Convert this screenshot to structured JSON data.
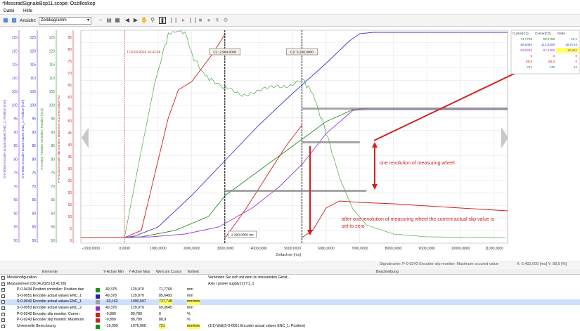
{
  "window": {
    "title": "*MessradSignaleBsp11.scope: Oszilloskop"
  },
  "menu": {
    "file": "Datei",
    "help": "Hilfe"
  },
  "toolbar": {
    "view_label": "Ansicht:",
    "view_value": "Zeitdiagramm"
  },
  "axes": {
    "left": [
      {
        "label": "S-0-0053 Encoder actual values ENC_2: Position [mm]",
        "color": "#7a2fd0",
        "ticks": [
          "125",
          "120",
          "115",
          "110",
          "105",
          "100",
          "95",
          "90",
          "85",
          "80",
          "75",
          "70",
          "65",
          "60",
          "55",
          "50"
        ]
      },
      {
        "label": "S-0-0051 Encoder actual values ENC_1: Position [mm]",
        "color": "#2f2fd0",
        "ticks": [
          "125",
          "120",
          "115",
          "110",
          "105",
          "100",
          "95",
          "90",
          "85",
          "80",
          "75",
          "70",
          "65",
          "60",
          "55",
          "50"
        ]
      },
      {
        "label": "P-0-0434 Position controller: Position [mm]",
        "color": "#2a8a2a",
        "ticks": [
          "125",
          "120",
          "115",
          "110",
          "105",
          "100",
          "95",
          "90",
          "85",
          "80",
          "75",
          "70",
          "65",
          "60",
          "55",
          "50"
        ]
      },
      {
        "label": "P-0-0243 Encoder slip monitor: Maximum occurred value [%]",
        "color": "#d02020",
        "ticks": [
          "85",
          "80",
          "75",
          "70",
          "65",
          "60",
          "55",
          "50",
          "45",
          "40",
          "35",
          "30",
          "25",
          "20",
          "15",
          "10",
          "5",
          "0"
        ]
      }
    ],
    "x_ticks": [
      "-1000,0000",
      "0,0000",
      "1000,0000",
      "2000,0000",
      "3000,0000",
      "4000,0000",
      "5000,0000",
      "6000,0000",
      "7000,0000",
      "8000,0000",
      "9000,0000",
      "10000,0000",
      "11000,0000"
    ],
    "x_label": "Zeitachse [ms]"
  },
  "chart_data": {
    "type": "line",
    "x_unit": "ms",
    "xlim": [
      -1300,
      11400
    ],
    "cursor_labels": {
      "trigger": "T 03.04.2023 18:32:46",
      "c1": "C1: 2,984,0000",
      "c2": "C2: 5,280,0000",
      "delta": "2.290,0000 ms"
    }
  },
  "cursor_panel": {
    "headers": [
      "Cursor(C1)",
      "Cursor(C2)",
      "Delta"
    ],
    "rows": [
      [
        "71,7769",
        "90,0769",
        "19,1"
      ],
      [
        "85,6493",
        "113,9209",
        "28,0716"
      ],
      [
        "69,0645",
        "87,9469",
        "18,882"
      ],
      [
        "0",
        "0",
        "0"
      ],
      [
        "88,9",
        "88,9",
        "0"
      ],
      [
        "721",
        "745",
        "24"
      ]
    ]
  },
  "annotations": {
    "one_rev": "one revolution of measuring wheel",
    "after_rev": "after one revolution of measuring wheel the current actual slip value is set to zero"
  },
  "status": {
    "signal": "Signalname: P-0-0243 Encoder slip monitor: Maximum occured value",
    "coords": "X: 6,402,000 [ms]   Y: 88,9 [%]"
  },
  "table": {
    "headers": [
      "Elemente",
      "Y-Achse Min",
      "Y-Achse Max",
      "Wert am Cursor",
      "Einheit",
      "Beschreibung"
    ],
    "rows": [
      {
        "name": "Messkonfiguration",
        "min": "",
        "max": "",
        "val": "",
        "unit": "",
        "desc": "Verbinden Sie sich mit dem zu messenden Gerät...",
        "color": "",
        "checked": false
      },
      {
        "name": "Measurement (03.04.2023 18:41:00)",
        "min": "",
        "max": "",
        "val": "",
        "unit": "",
        "desc": "Axis / power supply [1] Y1_1",
        "color": "",
        "checked": true
      },
      {
        "name": "P-0-0434 Position controller: Position dee",
        "min": "49,378",
        "max": "129,970",
        "val": "71,7769",
        "unit": "mm",
        "desc": "",
        "color": "#1a8a1a",
        "checked": true
      },
      {
        "name": "S-0-0051 Encoder actual values ENC_1",
        "min": "49,378",
        "max": "129,970",
        "val": "85,6493",
        "unit": "mm",
        "desc": "",
        "color": "#2020c0",
        "checked": true
      },
      {
        "name": "S-0-0040 Encoder actual values ENC_1",
        "min": "-63,162",
        "max": "1090,597",
        "val": "737,748",
        "unit": "mm/min",
        "desc": "",
        "color": "#a0a0a0",
        "checked": false
      },
      {
        "name": "S-0-0053 Encoder actual values ENC_2",
        "min": "49,378",
        "max": "129,970",
        "val": "69,0645",
        "unit": "mm",
        "desc": "",
        "color": "#8a2fd0",
        "checked": true
      },
      {
        "name": "P-0-0242 Encoder slip monitor: Curren",
        "min": "-0,889",
        "max": "89,789",
        "val": "0",
        "unit": "%",
        "desc": "",
        "color": "#d02020",
        "checked": true
      },
      {
        "name": "P-0-0243 Encoder slip monitor: Maximum",
        "min": "-0,889",
        "max": "89,789",
        "val": "88,9",
        "unit": "%",
        "desc": "",
        "color": "#d02020",
        "checked": true
      },
      {
        "name": "Universelle Berechnung",
        "min": "-19,000",
        "max": "1076,000",
        "val": "721",
        "unit": "mm/min",
        "desc": "(1/1)*d/dt(S-0-0051 Encoder actual values ENC_1: Position)",
        "color": "#1a8a1a",
        "checked": true
      }
    ]
  }
}
